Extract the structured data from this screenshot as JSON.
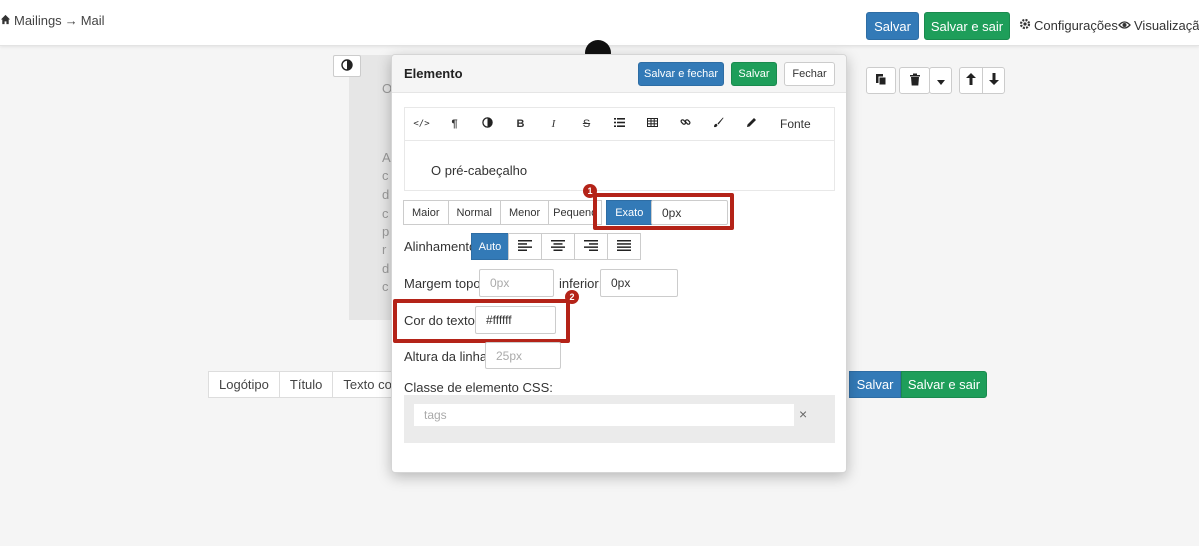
{
  "breadcrumb": {
    "home": "Mailings",
    "arrow": "→",
    "page": "Mail"
  },
  "topbar": {
    "save": "Salvar",
    "save_exit": "Salvar e sair",
    "settings": "Configurações",
    "preview": "Visualização"
  },
  "background": {
    "ghost_letters": [
      "O",
      "A",
      "c",
      "d",
      "c",
      "p",
      "r",
      "d",
      "c"
    ]
  },
  "tabs": [
    "Logótipo",
    "Título",
    "Texto com"
  ],
  "bottom_buttons": {
    "save": "Salvar",
    "save_exit": "Salvar e sair"
  },
  "modal": {
    "title": "Elemento",
    "save_close": "Salvar e fechar",
    "save": "Salvar",
    "close": "Fechar",
    "toolbar_font": "Fonte",
    "editor_text": "O pré-cabeçalho",
    "sizes": [
      "Maior",
      "Normal",
      "Menor",
      "Pequeno",
      "Exato"
    ],
    "exact_value": "0px",
    "align_label": "Alinhamento",
    "align_auto": "Auto",
    "margin_top_label": "Margem topo:",
    "margin_top_placeholder": "0px",
    "margin_bottom_label": "inferior:",
    "margin_bottom_value": "0px",
    "text_color_label": "Cor do texto:",
    "text_color_value": "#ffffff",
    "line_height_label": "Altura da linha:",
    "line_height_placeholder": "25px",
    "css_class_label": "Classe de elemento CSS:",
    "tags_placeholder": "tags",
    "tags_clear": "×"
  },
  "annotations": {
    "badge1": "1",
    "badge2": "2"
  },
  "colors": {
    "primary": "#337ab7",
    "success": "#1e9e5a",
    "highlight": "#b42318"
  }
}
